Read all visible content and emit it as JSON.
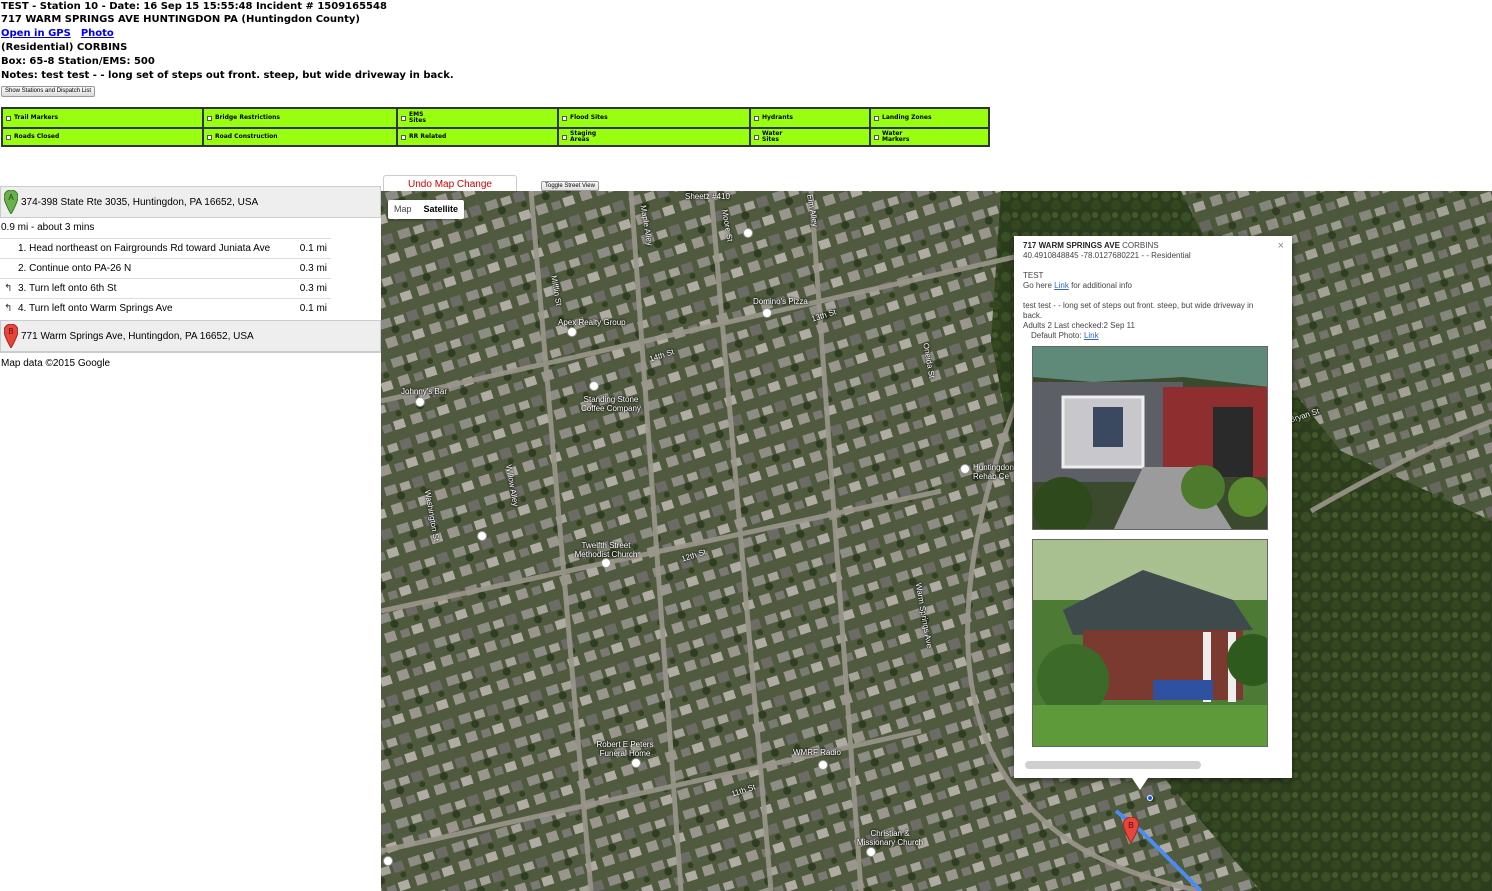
{
  "header": {
    "line1": "TEST - Station 10 - Date: 16 Sep 15   15:55:48     Incident # 1509165548",
    "line2": "717 WARM SPRINGS AVE HUNTINGDON PA (Huntingdon County)",
    "gps_link": "Open in GPS",
    "photo_link": "Photo",
    "line4": "(Residential) CORBINS",
    "line5": "Box: 65-8 Station/EMS: 500",
    "line6": "Notes: test test - - long set of steps out front. steep, but wide driveway in back.",
    "show_button": "Show Stations and Dispatch List"
  },
  "layers": [
    {
      "label": "Trail Markers"
    },
    {
      "label": "Bridge Restrictions"
    },
    {
      "label": "EMS Sites"
    },
    {
      "label": "Flood Sites"
    },
    {
      "label": "Hydrants"
    },
    {
      "label": "Landing Zones"
    },
    {
      "label": "Roads Closed"
    },
    {
      "label": "Road Construction"
    },
    {
      "label": "RR Related"
    },
    {
      "label": "Staging Areas"
    },
    {
      "label": "Water Sites"
    },
    {
      "label": "Water Markers"
    }
  ],
  "directions": {
    "start_letter": "A",
    "start": "374-398 State Rte 3035, Huntingdon, PA 16652, USA",
    "summary": "0.9 mi - about 3 mins",
    "steps": [
      {
        "num": "1.",
        "text": "Head northeast on Fairgrounds Rd toward Juniata Ave",
        "dist": "0.1 mi",
        "turn": ""
      },
      {
        "num": "2.",
        "text": "Continue onto PA-26 N",
        "dist": "0.3 mi",
        "turn": ""
      },
      {
        "num": "3.",
        "text": "Turn left onto 6th St",
        "dist": "0.3 mi",
        "turn": "↰"
      },
      {
        "num": "4.",
        "text": "Turn left onto Warm Springs Ave",
        "dist": "0.1 mi",
        "turn": "↰"
      }
    ],
    "end_letter": "B",
    "end": "771 Warm Springs Ave, Huntingdon, PA 16652, USA",
    "map_data": "Map data ©2015 Google"
  },
  "map": {
    "undo_label": "Undo Map Change",
    "toggle_label": "Toggle Street View",
    "type_map": "Map",
    "type_satellite": "Satellite",
    "labels": [
      {
        "text": "Sheetz #410"
      },
      {
        "text": "Mifflin St"
      },
      {
        "text": "Moore St"
      },
      {
        "text": "Elm Alley"
      },
      {
        "text": "Maple Alley"
      },
      {
        "text": "13th St"
      },
      {
        "text": "Domino's Pizza"
      },
      {
        "text": "Apex Realty Group"
      },
      {
        "text": "Johnny's Bar"
      },
      {
        "text": "Standing Stone Coffee Company"
      },
      {
        "text": "14th St"
      },
      {
        "text": "Huntingdon & Rehab Ce"
      },
      {
        "text": "Twelfth Street Methodist Church"
      },
      {
        "text": "12th St"
      },
      {
        "text": "Washington St"
      },
      {
        "text": "Willow Alley"
      },
      {
        "text": "Robert E Peters Funeral Home"
      },
      {
        "text": "WMRF Radio"
      },
      {
        "text": "11th St"
      },
      {
        "text": "Christian & Missionary Church"
      },
      {
        "text": "Warm Springs Ave"
      },
      {
        "text": "Oneida St"
      },
      {
        "text": "Bryan St"
      }
    ],
    "marker_b": "B"
  },
  "infowindow": {
    "address": "717 WARM SPRINGS AVE",
    "name": "CORBINS",
    "coords": "40.4910848845 -78.0127680221 - - Residential",
    "test": "TEST",
    "go_here_prefix": "Go here",
    "link_text": "Link",
    "go_here_suffix": "for additional info",
    "notes": "test test - - long set of steps out front. steep, but wide driveway in back.",
    "adults": "Adults 2 Last checked:2 Sep 11",
    "default_photo_prefix": "Default Photo:",
    "default_photo_link": "Link",
    "close": "×"
  },
  "colors": {
    "layer_green": "#99ff11",
    "pin_a": "#6ab04c",
    "pin_b": "#e8453c",
    "undo_red": "#cc0000",
    "link_blue": "#0000ee"
  }
}
